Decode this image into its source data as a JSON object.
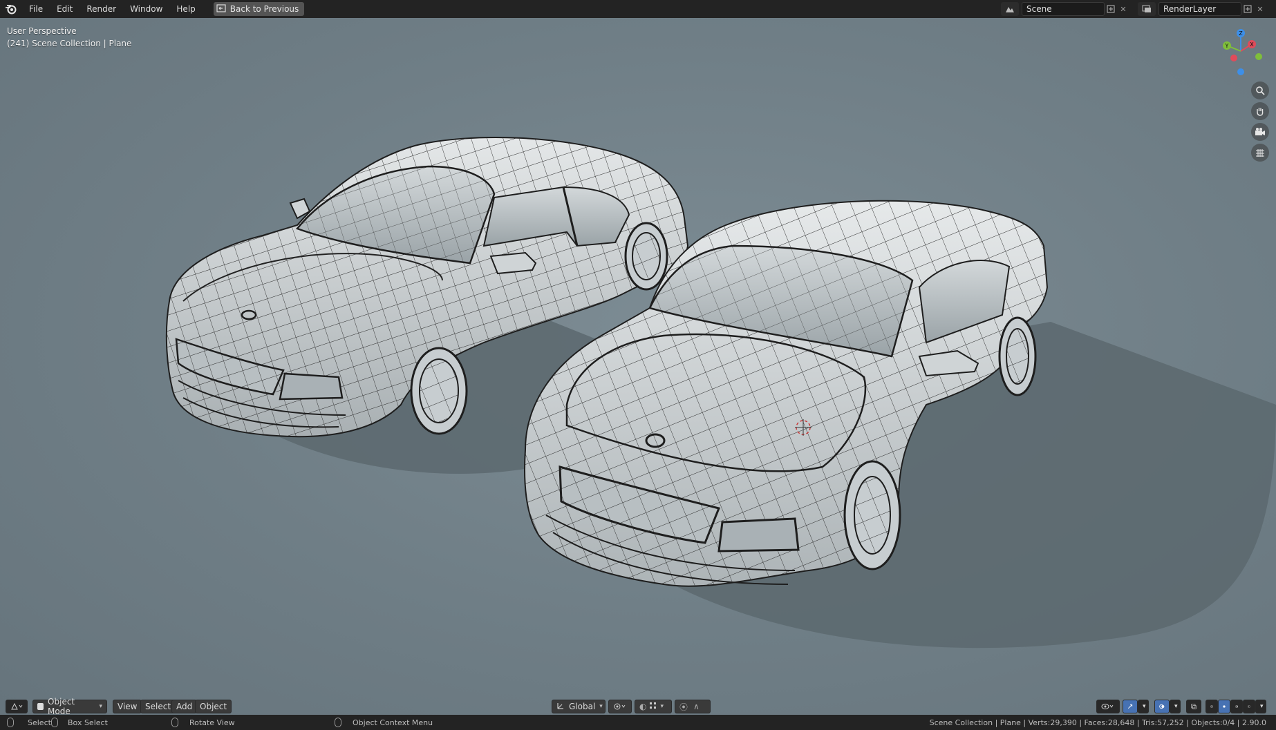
{
  "topbar": {
    "menu": [
      "File",
      "Edit",
      "Render",
      "Window",
      "Help"
    ],
    "back_button": "Back to Previous",
    "scene_field": "Scene",
    "render_layer_field": "RenderLayer"
  },
  "viewport": {
    "perspective_label": "User Perspective",
    "collection_label": "(241) Scene Collection | Plane"
  },
  "gizmo": {
    "axes": [
      "X",
      "Y",
      "Z"
    ],
    "colors": {
      "x": "#e04b5a",
      "y": "#7fbf3a",
      "z": "#3d8fe8"
    }
  },
  "header": {
    "mode": "Object Mode",
    "menus": [
      "View",
      "Select",
      "Add",
      "Object"
    ],
    "transform_orientation": "Global"
  },
  "statusbar": {
    "select": "Select",
    "box_select": "Box Select",
    "rotate_view": "Rotate View",
    "context_menu": "Object Context Menu",
    "stats": "Scene Collection | Plane | Verts:29,390 | Faces:28,648 | Tris:57,252 | Objects:0/4 | 2.90.0"
  },
  "colors": {
    "accent": "#4772b3",
    "viewport_bg": "#6f7e86",
    "topbar_bg": "#232323"
  }
}
